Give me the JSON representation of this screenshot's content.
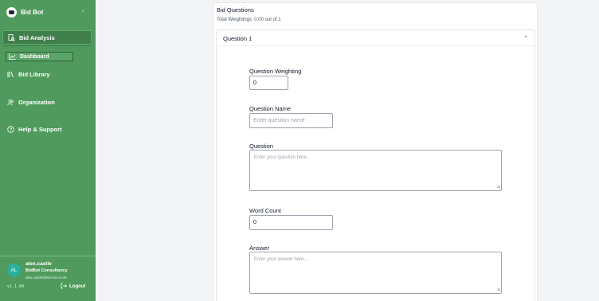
{
  "sidebar": {
    "brand": "Bid Bot",
    "nav": {
      "bid_analysis": "Bid Analysis",
      "dashboard": "Dashboard",
      "bid_library": "Bid Library",
      "organization": "Organization",
      "help": "Help & Support"
    },
    "user": {
      "initials": "AL",
      "name": "alex.castle",
      "company": "BidBot Consultancy",
      "email": "alex.castle@bid-bot.co.uk"
    },
    "version": "v1.1.84",
    "logout": "Logout"
  },
  "main": {
    "title": "Bid Questions",
    "subtitle": "Total Weightings: 0.00 out of 1",
    "question": {
      "header": "Question 1",
      "weighting_label": "Question Weighting",
      "weighting_value": "0",
      "name_label": "Question Name",
      "name_placeholder": "Enter question name",
      "question_label": "Question",
      "question_placeholder": "Enter your question here...",
      "word_count_label": "Word Count",
      "word_count_value": "0",
      "answer_label": "Answer",
      "answer_placeholder": "Enter your answer here..."
    }
  }
}
